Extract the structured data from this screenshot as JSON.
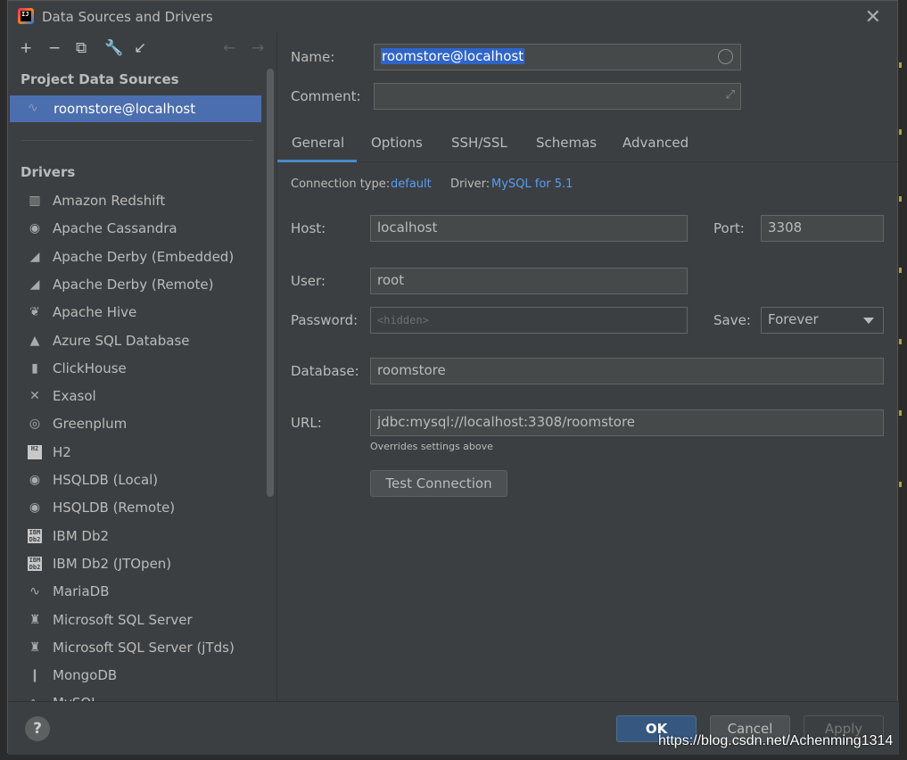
{
  "window": {
    "title": "Data Sources and Drivers",
    "close_glyph": "✕",
    "icon_text": "IJ"
  },
  "toolbar": {
    "add": "+",
    "remove": "−",
    "copy": "⧉",
    "settings": "🔧",
    "import": "↙",
    "back": "←",
    "forward": "→"
  },
  "project": {
    "heading": "Project Data Sources",
    "items": [
      {
        "label": "roomstore@localhost",
        "icon": "mysql-dolphin-icon"
      }
    ]
  },
  "drivers": {
    "heading": "Drivers",
    "items": [
      {
        "label": "Amazon Redshift",
        "icon": "▥"
      },
      {
        "label": "Apache Cassandra",
        "icon": "◉"
      },
      {
        "label": "Apache Derby (Embedded)",
        "icon": "◢"
      },
      {
        "label": "Apache Derby (Remote)",
        "icon": "◢"
      },
      {
        "label": "Apache Hive",
        "icon": "❦"
      },
      {
        "label": "Azure SQL Database",
        "icon": "▲"
      },
      {
        "label": "ClickHouse",
        "icon": "▮"
      },
      {
        "label": "Exasol",
        "icon": "✕"
      },
      {
        "label": "Greenplum",
        "icon": "◎"
      },
      {
        "label": "H2",
        "icon": "H2"
      },
      {
        "label": "HSQLDB (Local)",
        "icon": "◉"
      },
      {
        "label": "HSQLDB (Remote)",
        "icon": "◉"
      },
      {
        "label": "IBM Db2",
        "icon": "IBM Db2"
      },
      {
        "label": "IBM Db2 (JTOpen)",
        "icon": "IBM Db2"
      },
      {
        "label": "MariaDB",
        "icon": "∿"
      },
      {
        "label": "Microsoft SQL Server",
        "icon": "♜"
      },
      {
        "label": "Microsoft SQL Server (jTds)",
        "icon": "♜"
      },
      {
        "label": "MongoDB",
        "icon": "❙"
      },
      {
        "label": "MySQL",
        "icon": "∿"
      }
    ]
  },
  "form": {
    "name_label": "Name:",
    "name_value": "roomstore@localhost",
    "comment_label": "Comment:",
    "comment_value": "",
    "tabs": [
      "General",
      "Options",
      "SSH/SSL",
      "Schemas",
      "Advanced"
    ],
    "active_tab": "General",
    "connection_type_label": "Connection type:",
    "connection_type_value": "default",
    "driver_label": "Driver:",
    "driver_value": "MySQL for 5.1",
    "host_label": "Host:",
    "host_value": "localhost",
    "port_label": "Port:",
    "port_value": "3308",
    "user_label": "User:",
    "user_value": "root",
    "password_label": "Password:",
    "password_placeholder": "<hidden>",
    "save_label": "Save:",
    "save_value": "Forever",
    "database_label": "Database:",
    "database_value": "roomstore",
    "url_label": "URL:",
    "url_value": "jdbc:mysql://localhost:3308/roomstore",
    "url_hint": "Overrides settings above",
    "test_connection": "Test Connection"
  },
  "footer": {
    "help": "?",
    "ok": "OK",
    "cancel": "Cancel",
    "apply": "Apply"
  },
  "watermark": "https://blog.csdn.net/Achenming1314",
  "colors": {
    "accent": "#4b6eaf",
    "link": "#589df6",
    "primary_button": "#365880",
    "tab_underline": "#4a88c7"
  }
}
